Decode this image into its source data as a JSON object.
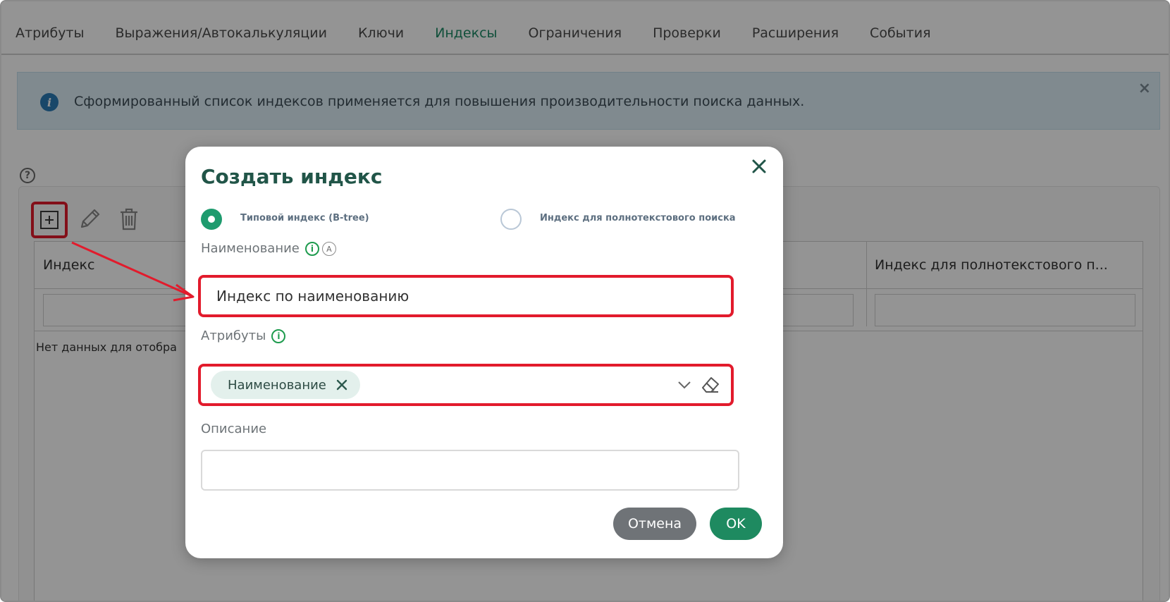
{
  "tabs": [
    "Атрибуты",
    "Выражения/Автокалькуляции",
    "Ключи",
    "Индексы",
    "Ограничения",
    "Проверки",
    "Расширения",
    "События"
  ],
  "active_tab": "Индексы",
  "info_banner": {
    "text": "Сформированный список индексов применяется для повышения производительности поиска данных.",
    "close": "×"
  },
  "help_icon": "?",
  "grid": {
    "columns": [
      "Индекс",
      "Индекс для полнотекстового п..."
    ],
    "empty_text": "Нет данных для отобра"
  },
  "modal": {
    "title": "Создать индекс",
    "radio_btree": "Типовой индекс (B-tree)",
    "radio_fulltext": "Индекс для полнотекстового поиска",
    "name_label": "Наименование",
    "name_value": "Индекс по наименованию",
    "attributes_label": "Атрибуты",
    "attribute_chip": "Наименование",
    "description_label": "Описание",
    "description_value": "",
    "cancel": "Отмена",
    "ok": "OK"
  },
  "icons": {
    "info_letter": "i",
    "auto_letter": "A"
  },
  "colors": {
    "accent": "#1e8a60",
    "highlight": "#e21b2c"
  }
}
